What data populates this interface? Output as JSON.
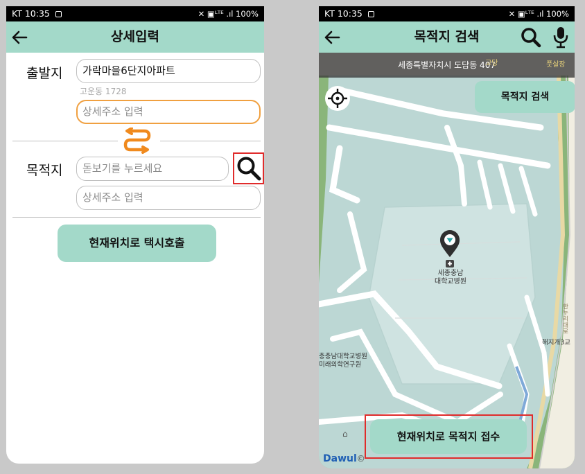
{
  "left": {
    "status": {
      "time": "KT 10:35",
      "indicators": "✕ ▣ᴸᵀᴱ .ıl 100%"
    },
    "appbar": {
      "title": "상세입력"
    },
    "origin": {
      "label": "출발지",
      "address_value": "가락마을6단지아파트",
      "sub_address": "고운동 1728",
      "detail_placeholder": "상세주소 입력"
    },
    "destination": {
      "label": "목적지",
      "search_placeholder": "돋보기를 누르세요",
      "detail_placeholder": "상세주소 입력"
    },
    "call_button": "현재위치로 택시호출"
  },
  "right": {
    "status": {
      "time": "KT 10:35",
      "indicators": "✕ ▣ᴸᵀᴱ .ıl 100%"
    },
    "appbar": {
      "title": "목적지 검색"
    },
    "address_banner": "세종특별자치시 도담동 407",
    "banner_side_labels": [
      "고당",
      "풋살장"
    ],
    "search_button": "목적지 검색",
    "map": {
      "hospital_label_1": "세종충남",
      "hospital_label_2": "대학교병원",
      "left_label_1": "충충남대학교병원",
      "left_label_2": "미래의학연구원",
      "bridge_label": "해지개3교",
      "road_label": "한누리대로",
      "brand": "Dawul"
    },
    "accept_button": "현재위치로 목적지 접수"
  },
  "colors": {
    "accent": "#a3d9c9",
    "focus": "#f0a040",
    "swap": "#f08a1e",
    "highlight": "#e02b2b"
  }
}
